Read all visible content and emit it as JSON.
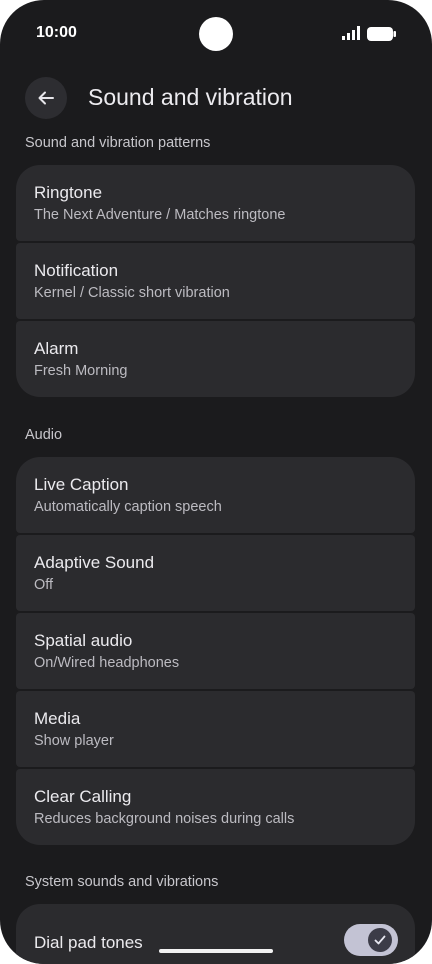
{
  "status_bar": {
    "time": "10:00"
  },
  "header": {
    "title": "Sound and vibration"
  },
  "sections": [
    {
      "header": "Sound and vibration patterns",
      "items": [
        {
          "title": "Ringtone",
          "summary": "The Next Adventure / Matches ringtone"
        },
        {
          "title": "Notification",
          "summary": "Kernel / Classic short vibration"
        },
        {
          "title": "Alarm",
          "summary": "Fresh Morning"
        }
      ]
    },
    {
      "header": "Audio",
      "items": [
        {
          "title": "Live Caption",
          "summary": "Automatically caption speech"
        },
        {
          "title": "Adaptive Sound",
          "summary": "Off"
        },
        {
          "title": "Spatial audio",
          "summary": "On/Wired headphones"
        },
        {
          "title": "Media",
          "summary": "Show player"
        },
        {
          "title": "Clear Calling",
          "summary": "Reduces background noises during calls"
        }
      ]
    },
    {
      "header": "System sounds and vibrations",
      "items": [
        {
          "title": "Dial pad tones",
          "toggle_on": true
        }
      ]
    }
  ],
  "icons": {
    "back": "back-arrow-icon",
    "signal": "cellular-signal-icon",
    "battery": "battery-icon",
    "check": "check-icon"
  },
  "colors": {
    "background": "#1b1b1d",
    "card": "#2b2b2e",
    "toggle_track": "#c3c3d4"
  }
}
